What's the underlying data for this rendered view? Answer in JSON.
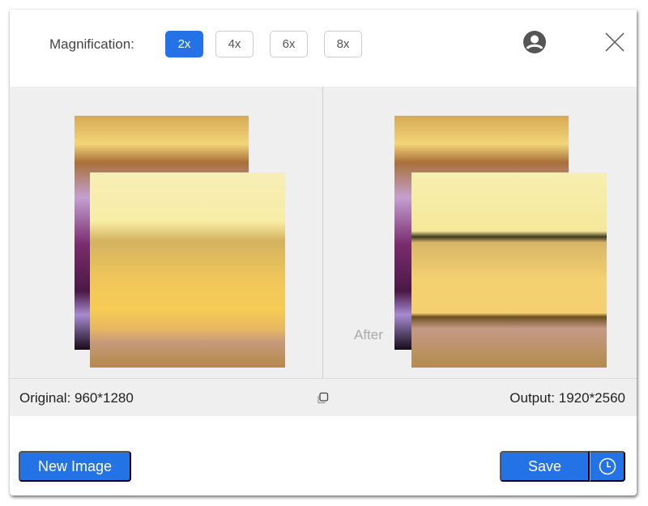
{
  "header": {
    "magnification_label": "Magnification:",
    "options": [
      {
        "label": "2x",
        "active": true
      },
      {
        "label": "4x",
        "active": false
      },
      {
        "label": "6x",
        "active": false
      },
      {
        "label": "8x",
        "active": false
      }
    ],
    "user_icon": "user-circle-icon",
    "close_icon": "close-icon"
  },
  "preview": {
    "after_text": "After"
  },
  "status": {
    "original": "Original: 960*1280",
    "output": "Output: 1920*2560",
    "compare_icon": "copy-icon"
  },
  "footer": {
    "new_image": "New Image",
    "save": "Save",
    "history_icon": "clock-icon"
  },
  "colors": {
    "accent": "#2473e6"
  }
}
